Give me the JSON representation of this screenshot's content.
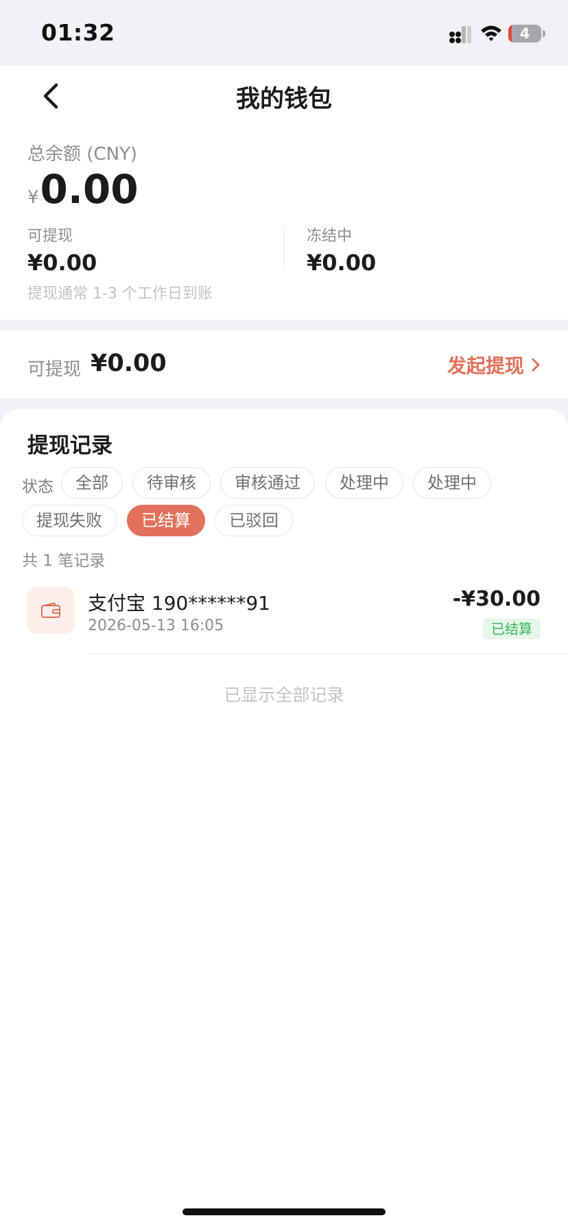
{
  "status_bar": {
    "time": "01:32",
    "battery": "4"
  },
  "nav": {
    "title": "我的钱包"
  },
  "balance": {
    "total_label": "总余额 (CNY)",
    "currency_symbol": "¥",
    "total_amount": "0.00",
    "withdrawable_label": "可提现",
    "withdrawable_amount": "¥0.00",
    "frozen_label": "冻结中",
    "frozen_amount": "¥0.00",
    "hint": "提现通常 1-3 个工作日到账"
  },
  "withdraw": {
    "label": "可提现",
    "amount": "¥0.00",
    "action_label": "发起提现"
  },
  "records": {
    "title": "提现记录",
    "status_label": "状态",
    "filters": [
      {
        "label": "全部",
        "active": false
      },
      {
        "label": "待审核",
        "active": false
      },
      {
        "label": "审核通过",
        "active": false
      },
      {
        "label": "处理中",
        "active": false
      },
      {
        "label": "处理中",
        "active": false
      },
      {
        "label": "提现失败",
        "active": false
      },
      {
        "label": "已结算",
        "active": true
      },
      {
        "label": "已驳回",
        "active": false
      }
    ],
    "count_text": "共 1 笔记录",
    "items": [
      {
        "title": "支付宝 190******91",
        "time": "2026-05-13 16:05",
        "amount": "-¥30.00",
        "status": "已结算"
      }
    ],
    "footer": "已显示全部记录"
  },
  "colors": {
    "accent": "#e2705a",
    "success": "#3bb35e",
    "page_bg": "#f1f1f6"
  }
}
